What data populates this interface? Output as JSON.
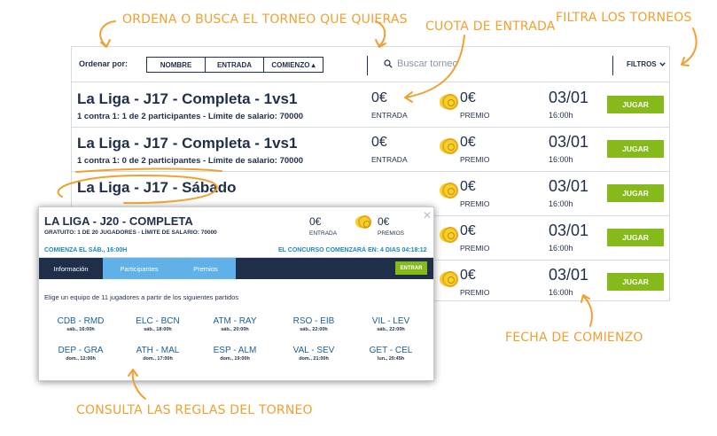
{
  "annotations": {
    "order_search": "ORDENA O BUSCA EL TORNEO QUE QUIERAS",
    "entry_fee": "CUOTA DE ENTRADA",
    "filter": "FILTRA LOS TORNEOS",
    "start_date": "FECHA DE COMIENZO",
    "rules": "CONSULTA LAS REGLAS DEL TORNEO"
  },
  "toolbar": {
    "sort_label": "Ordenar por:",
    "sort_options": [
      "NOMBRE",
      "ENTRADA",
      "COMIENZO ▴"
    ],
    "search_placeholder": "Buscar torneo",
    "filters_label": "FILTROS"
  },
  "tournaments": [
    {
      "name": "La Liga - J17 - Completa - 1vs1",
      "sub": "1 contra 1: 1 de 2 participantes - Límite de salario: 70000",
      "fee": "0€",
      "fee_label": "ENTRADA",
      "prize": "0€",
      "prize_label": "PREMIO",
      "date": "03/01",
      "time": "16:00h",
      "play": "JUGAR"
    },
    {
      "name": "La Liga - J17 - Completa - 1vs1",
      "sub": "1 contra 1: 0 de 2 participantes - Límite de salario: 70000",
      "fee": "0€",
      "fee_label": "ENTRADA",
      "prize": "0€",
      "prize_label": "PREMIO",
      "date": "03/01",
      "time": "16:00h",
      "play": "JUGAR"
    },
    {
      "name": "La Liga - J17 - Sábado",
      "sub": "",
      "fee": "",
      "fee_label": "",
      "prize": "0€",
      "prize_label": "PREMIO",
      "date": "03/01",
      "time": "16:00h",
      "play": "JUGAR"
    },
    {
      "name": "",
      "sub": "",
      "fee": "",
      "fee_label": "",
      "prize": "0€",
      "prize_label": "PREMIO",
      "date": "03/01",
      "time": "16:00h",
      "play": "JUGAR"
    },
    {
      "name": "",
      "sub": "",
      "fee": "",
      "fee_label": "",
      "prize": "0€",
      "prize_label": "PREMIO",
      "date": "03/01",
      "time": "16:00h",
      "play": "JUGAR"
    }
  ],
  "popup": {
    "title": "LA LIGA - J20 - COMPLETA",
    "subtitle": "GRATUITO: 1 DE 20 JUGADORES - LÍMITE DE SALARIO: 70000",
    "fee": "0€",
    "fee_label": "ENTRADA",
    "prize": "0€",
    "prize_label": "PREMIOS",
    "close": "✕",
    "start": "COMIENZA EL SÁB., 16:00H",
    "countdown": "EL CONCURSO COMENZARÁ EN:  4 DIAS 04:18:12",
    "tabs": [
      "Información",
      "Participantes",
      "Premios"
    ],
    "enter": "ENTRAR",
    "instructions": "Elige un equipo de 11 jugadores a partir de los siguientes partidos",
    "matches": [
      {
        "name": "CDB - RMD",
        "time": "sáb., 16:00h"
      },
      {
        "name": "ELC - BCN",
        "time": "sáb., 18:00h"
      },
      {
        "name": "ATM - RAY",
        "time": "sáb., 20:00h"
      },
      {
        "name": "RSO - EIB",
        "time": "sáb., 22:00h"
      },
      {
        "name": "VIL - LEV",
        "time": "sáb., 22:00h"
      },
      {
        "name": "DEP - GRA",
        "time": "dom., 12:00h"
      },
      {
        "name": "ATH - MAL",
        "time": "dom., 17:00h"
      },
      {
        "name": "ESP - ALM",
        "time": "dom., 19:00h"
      },
      {
        "name": "VAL - SEV",
        "time": "dom., 21:00h"
      },
      {
        "name": "GET - CEL",
        "time": "lun., 20:45h"
      }
    ]
  },
  "colors": {
    "accent_orange": "#f0a030",
    "navy": "#1f2f4a",
    "play_green": "#86b91a",
    "link_blue": "#1a86c9",
    "tab_blue": "#5fb1e8",
    "coin_gold": "#f7d02a"
  }
}
